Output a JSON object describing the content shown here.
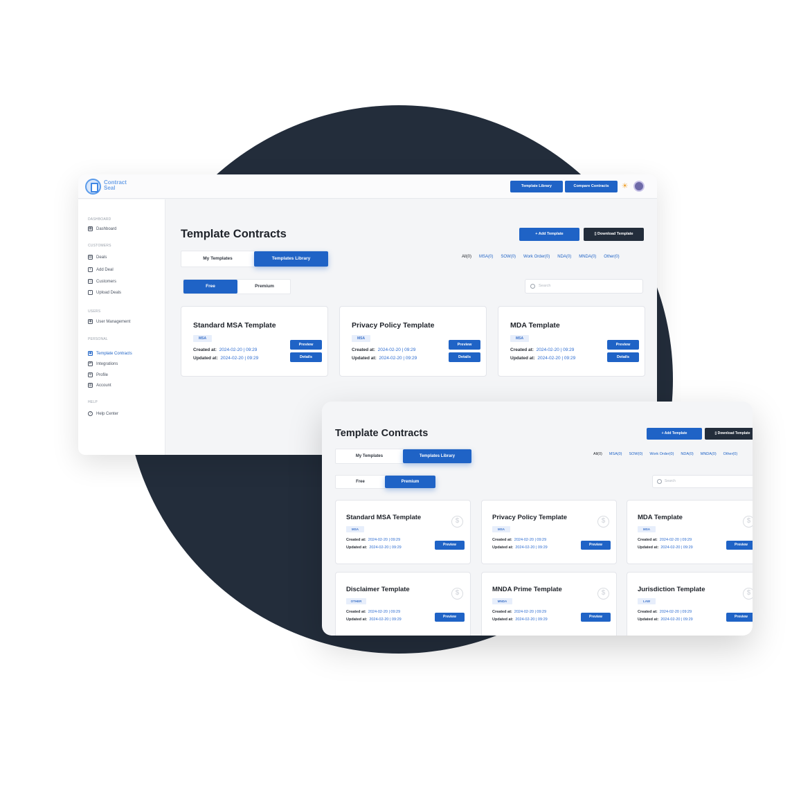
{
  "app": {
    "logo_text": "Contract Seal"
  },
  "header": {
    "template_library": "Template Library",
    "compare_contracts": "Compare Contracts"
  },
  "sidebar": {
    "dashboard_section": "DASHBOARD",
    "dashboard": "Dashboard",
    "customers_section": "CUSTOMERS",
    "deals": "Deals",
    "add_deal": "Add Deal",
    "customers": "Customers",
    "upload_deals": "Upload Deals",
    "users_section": "USERS",
    "user_management": "User Management",
    "personal_section": "PERSONAL",
    "template_contracts": "Template Contracts",
    "integrations": "Integrations",
    "profile": "Profile",
    "account": "Account",
    "help_section": "HELP",
    "help_center": "Help Center"
  },
  "page": {
    "title": "Template Contracts",
    "add_template": "+ Add Template",
    "download_template": "Download Template",
    "tabs": {
      "my_templates": "My Templates",
      "templates_library": "Templates Library"
    },
    "pricing": {
      "free": "Free",
      "premium": "Premium"
    },
    "search_placeholder": "Search",
    "filters": [
      "All(0)",
      "MSA(0)",
      "SOW(0)",
      "Work Order(0)",
      "NDA(0)",
      "MNDA(0)",
      "Other(0)"
    ],
    "created_label": "Created at:",
    "updated_label": "Updated at:",
    "preview": "Preview",
    "details": "Details"
  },
  "free_cards": [
    {
      "title": "Standard MSA Template",
      "tag": "MSA",
      "created": "2024-02-20 | 09:29",
      "updated": "2024-02-20 | 09:29"
    },
    {
      "title": "Privacy Policy Template",
      "tag": "MSA",
      "created": "2024-02-20 | 09:29",
      "updated": "2024-02-20 | 09:29"
    },
    {
      "title": "MDA Template",
      "tag": "MSA",
      "created": "2024-02-20 | 09:29",
      "updated": "2024-02-20 | 09:29"
    }
  ],
  "premium_cards": [
    {
      "title": "Standard MSA Template",
      "tag": "MSA",
      "created": "2024-02-20 | 09:29",
      "updated": "2024-02-20 | 09:29"
    },
    {
      "title": "Privacy Policy Template",
      "tag": "MSA",
      "created": "2024-02-20 | 09:29",
      "updated": "2024-02-20 | 09:29"
    },
    {
      "title": "MDA Template",
      "tag": "MSA",
      "created": "2024-02-20 | 09:29",
      "updated": "2024-02-20 | 09:29"
    },
    {
      "title": "Disclaimer Template",
      "tag": "OTHER",
      "created": "2024-02-20 | 09:29",
      "updated": "2024-02-20 | 09:29"
    },
    {
      "title": "MNDA Prime Template",
      "tag": "MNDA",
      "created": "2024-02-20 | 09:29",
      "updated": "2024-02-20 | 09:29"
    },
    {
      "title": "Jurisdiction Template",
      "tag": "LAW",
      "created": "2024-02-20 | 09:29",
      "updated": "2024-02-20 | 09:29"
    }
  ],
  "icons": {
    "currency": "$",
    "theme": "☀",
    "dashboard": "▦",
    "deals": "▤",
    "add_deal": "+",
    "customers": "◫",
    "upload": "↑",
    "users": "◉",
    "template": "▣",
    "integrations": "⇄",
    "profile": "⚙",
    "account": "▥",
    "help": "?"
  },
  "colors": {
    "primary": "#1f63c6",
    "dark": "#232d3b",
    "background": "#f4f5f7",
    "accent_sun": "#f0a63a"
  }
}
